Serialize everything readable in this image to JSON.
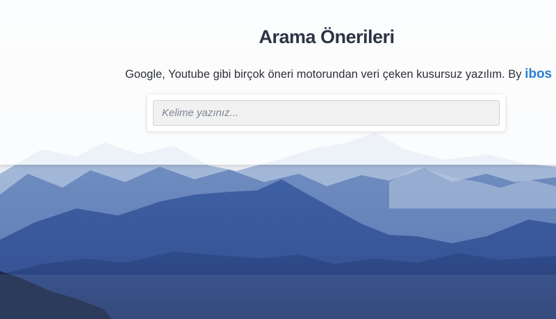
{
  "header": {
    "title": "Arama Önerileri",
    "subtitle": "Google, Youtube gibi birçok öneri motorundan veri çeken kusursuz yazılım. By ",
    "brand": "ibos"
  },
  "search": {
    "value": "",
    "placeholder": "Kelime yazınız..."
  },
  "colors": {
    "brand": "#2b7fd1",
    "title": "#2c3444"
  }
}
